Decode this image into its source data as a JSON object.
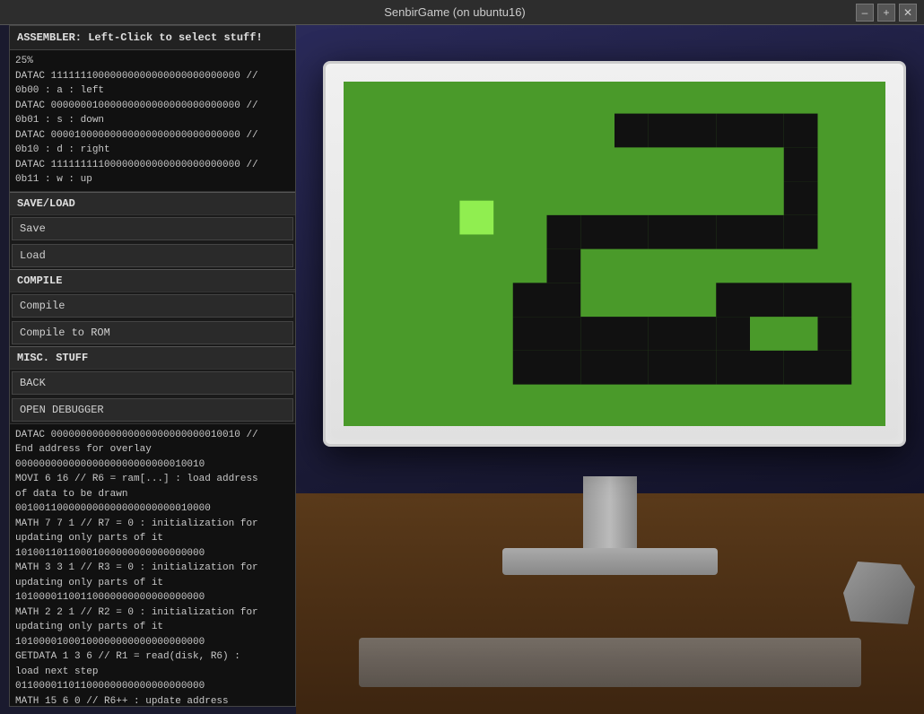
{
  "titlebar": {
    "title": "SenbirGame (on ubuntu16)",
    "buttons": {
      "minimize": "–",
      "maximize": "+",
      "close": "✕"
    }
  },
  "left_panel": {
    "assembler_header": "ASSEMBLER: Left-Click to select stuff!",
    "code_top": [
      "25%",
      "DATAC 11111110000000000000000000000000 //",
      "0b00 : a : left",
      "DATAC 00000001000000000000000000000000 //",
      "0b01 : s : down",
      "DATAC 00001000000000000000000000000000 //",
      "0b10 : d : right",
      "DATAC 11111111100000000000000000000000 //",
      "0b11 : w : up"
    ],
    "save_load_label": "SAVE/LOAD",
    "save_btn": "Save",
    "load_btn": "Load",
    "compile_label": "COMPILE",
    "compile_btn": "Compile",
    "compile_to_rom_btn": "Compile to ROM",
    "misc_label": "MISC. STUFF",
    "back_btn": "BACK",
    "open_debugger_btn": "OPEN DEBUGGER",
    "code_bottom": [
      "DATAC 00000000000000000000000000010010 //",
      "End address for overlay",
      "00000000000000000000000000010010",
      "MOVI 6 16 // R6 = ram[...] : load address",
      "of data to be drawn",
      "001001100000000000000000000010000",
      "MATH 7 7 1 // R7 = 0 : initialization for",
      "updating only parts of it",
      "10100110110001000000000000000000",
      "MATH 3 3 1 // R3 = 0 : initialization for",
      "updating only parts of it",
      "10100001100110000000000000000000",
      "MATH 2 2 1 // R2 = 0 : initialization for",
      "updating only parts of it",
      "10100001000100000000000000000000",
      "GETDATA 1 3 6 // R1 = read(disk, R6) :",
      "load next step",
      "01100001101100000000000000000000",
      "MATH 15 6 0 // R6++ : update address"
    ]
  }
}
